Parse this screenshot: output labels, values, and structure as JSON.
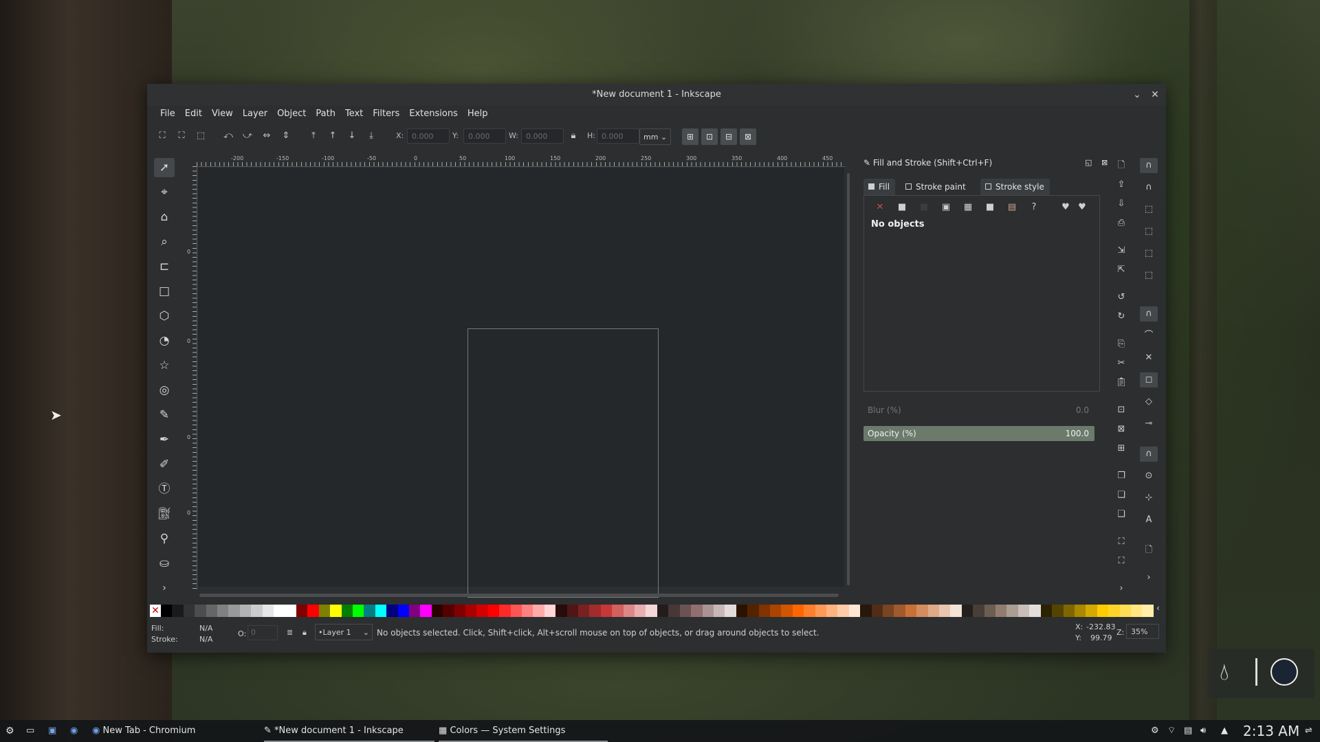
{
  "window": {
    "title": "*New document 1 - Inkscape",
    "minimize_glyph": "⌄",
    "close_glyph": "✕"
  },
  "menu": [
    "File",
    "Edit",
    "View",
    "Layer",
    "Object",
    "Path",
    "Text",
    "Filters",
    "Extensions",
    "Help"
  ],
  "toolbar": {
    "x_label": "X:",
    "x_value": "0.000",
    "y_label": "Y:",
    "y_value": "0.000",
    "w_label": "W:",
    "w_value": "0.000",
    "h_label": "H:",
    "h_value": "0.000",
    "unit": "mm"
  },
  "ruler": {
    "top_labels": [
      "-200",
      "-150",
      "-100",
      "-50",
      "0",
      "50",
      "100",
      "150",
      "200",
      "250",
      "300",
      "350",
      "400",
      "450"
    ],
    "left_labels": [
      "0",
      "0",
      "0",
      "0"
    ]
  },
  "dialog": {
    "title": "Fill and Stroke (Shift+Ctrl+F)",
    "tabs": [
      "Fill",
      "Stroke paint",
      "Stroke style"
    ],
    "no_objects": "No objects",
    "blur_label": "Blur (%)",
    "blur_value": "0.0",
    "opacity_label": "Opacity (%)",
    "opacity_value": "100.0"
  },
  "statusbar": {
    "fill_label": "Fill:",
    "fill_value": "N/A",
    "stroke_label": "Stroke:",
    "stroke_value": "N/A",
    "o_label": "O:",
    "o_value": "0",
    "layer": "•Layer 1",
    "message": "No objects selected. Click, Shift+click, Alt+scroll mouse on top of objects, or drag around objects to select.",
    "coord_x_label": "X:",
    "coord_x": "-232.83",
    "coord_y_label": "Y:",
    "coord_y": "99.79",
    "zoom_label": "Z:",
    "zoom": "35%"
  },
  "palette_colors": [
    "#000000",
    "#1a1a1a",
    "#333333",
    "#4d4d4d",
    "#666666",
    "#808080",
    "#999999",
    "#b3b3b3",
    "#cccccc",
    "#e6e6e6",
    "#ffffff",
    "#ffffff",
    "#800000",
    "#ff0000",
    "#808000",
    "#ffff00",
    "#008000",
    "#00ff00",
    "#008080",
    "#00ffff",
    "#000080",
    "#0000ff",
    "#800080",
    "#ff00ff",
    "#2b0000",
    "#550000",
    "#800000",
    "#aa0000",
    "#d40000",
    "#ff0000",
    "#ff2a2a",
    "#ff5555",
    "#ff8080",
    "#ffaaaa",
    "#ffd5d5",
    "#280b0b",
    "#501616",
    "#782121",
    "#a02c2c",
    "#c83737",
    "#d35f5f",
    "#de8787",
    "#e9afaf",
    "#f4d7d7",
    "#241c1c",
    "#483737",
    "#6c5353",
    "#916f6f",
    "#ac9393",
    "#c8b7b7",
    "#e3dbdb",
    "#2b1100",
    "#552200",
    "#803300",
    "#aa4400",
    "#d45500",
    "#ff6600",
    "#ff7f2a",
    "#ff9955",
    "#ffb380",
    "#ffccaa",
    "#ffe6d5",
    "#28170b",
    "#502d16",
    "#784421",
    "#a05a2c",
    "#c87137",
    "#d38d5f",
    "#deaa87",
    "#e9c6af",
    "#f4e3d7",
    "#241f1c",
    "#483e37",
    "#6c5d53",
    "#917c6f",
    "#ac9d93",
    "#c8beb7",
    "#e3dedb",
    "#2b2200",
    "#554400",
    "#806600",
    "#aa8800",
    "#d4aa00",
    "#ffcc00",
    "#ffd42a",
    "#ffdd55",
    "#ffe680",
    "#ffeeaa"
  ],
  "taskbar": {
    "tasks": [
      "New Tab - Chromium",
      "*New document 1 - Inkscape",
      "Colors — System Settings"
    ],
    "clock": "2:13 AM"
  }
}
